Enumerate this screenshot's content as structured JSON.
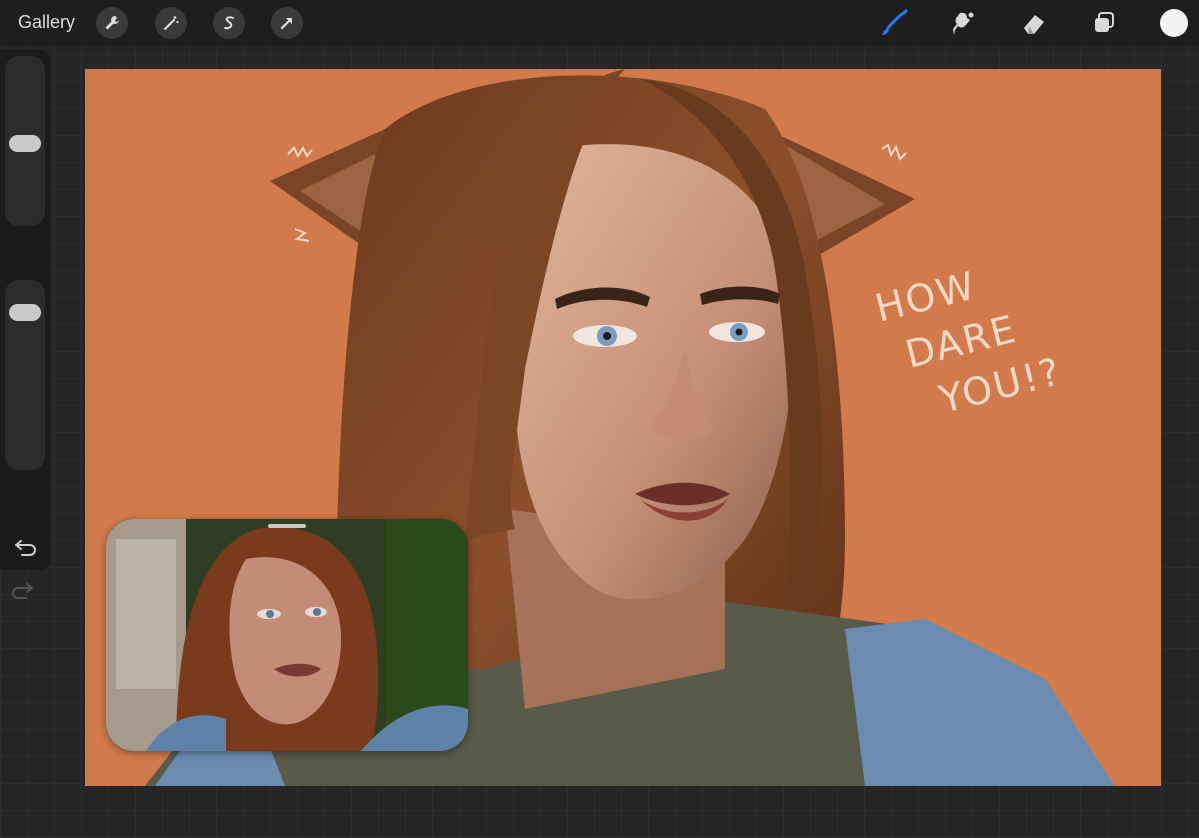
{
  "app": {
    "gallery_label": "Gallery"
  },
  "toolbar": {
    "left_tools": [
      "wrench-icon",
      "magic-wand-icon",
      "selection-s-icon",
      "transform-arrow-icon"
    ],
    "right_tools": [
      "brush-icon",
      "smudge-icon",
      "eraser-icon",
      "layers-icon"
    ],
    "active_tool": "brush-icon",
    "active_color": "#f2f2f2",
    "accent": "#1f7cf0"
  },
  "canvas": {
    "background": "#d27a4b",
    "text_lines": [
      "HOW",
      "DARE",
      "YOU!?"
    ]
  },
  "sidebar": {
    "undo_icon": "undo-icon",
    "redo_icon": "redo-icon"
  }
}
